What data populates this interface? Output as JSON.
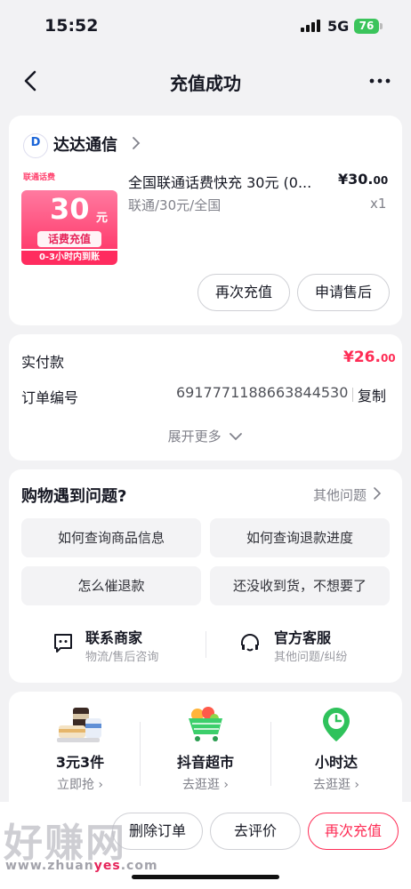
{
  "status": {
    "time": "15:52",
    "network": "5G",
    "battery": "76"
  },
  "nav": {
    "title": "充值成功"
  },
  "order": {
    "shop_name": "达达通信",
    "product_title": "全国联通话费快充 30元 (0...",
    "spec": "联通/30元/全国",
    "price_main": "¥30.",
    "price_dec": "00",
    "qty": "x1",
    "image": {
      "tag": "联通话费",
      "amount": "30",
      "unit": "元",
      "chip": "话费充值",
      "strip": "0-3小时内到账"
    },
    "recharge_again": "再次充值",
    "after_sale": "申请售后"
  },
  "payment": {
    "paid_label": "实付款",
    "paid_main": "¥26.",
    "paid_dec": "00",
    "order_no_label": "订单编号",
    "order_no": "6917771188663844530",
    "copy": "复制",
    "expand": "展开更多"
  },
  "help": {
    "title": "购物遇到问题?",
    "other": "其他问题",
    "questions": [
      "如何查询商品信息",
      "如何查询退款进度",
      "怎么催退款",
      "还没收到货，不想要了"
    ],
    "merchant_title": "联系商家",
    "merchant_sub": "物流/售后咨询",
    "service_title": "官方客服",
    "service_sub": "其他问题/纠纷"
  },
  "promos": [
    {
      "title": "3元3件",
      "sub": "立即抢"
    },
    {
      "title": "抖音超市",
      "sub": "去逛逛"
    },
    {
      "title": "小时达",
      "sub": "去逛逛"
    }
  ],
  "bottom": {
    "delete_order": "删除订单",
    "review": "去评价",
    "recharge": "再次充值"
  },
  "watermark": {
    "text": "好赚网",
    "url_a": "www.zhuan",
    "url_b": "yes",
    "url_c": ".com"
  },
  "colors": {
    "accent": "#fe2c55",
    "price_red": "#fe2c55",
    "green": "#3bc45b"
  }
}
